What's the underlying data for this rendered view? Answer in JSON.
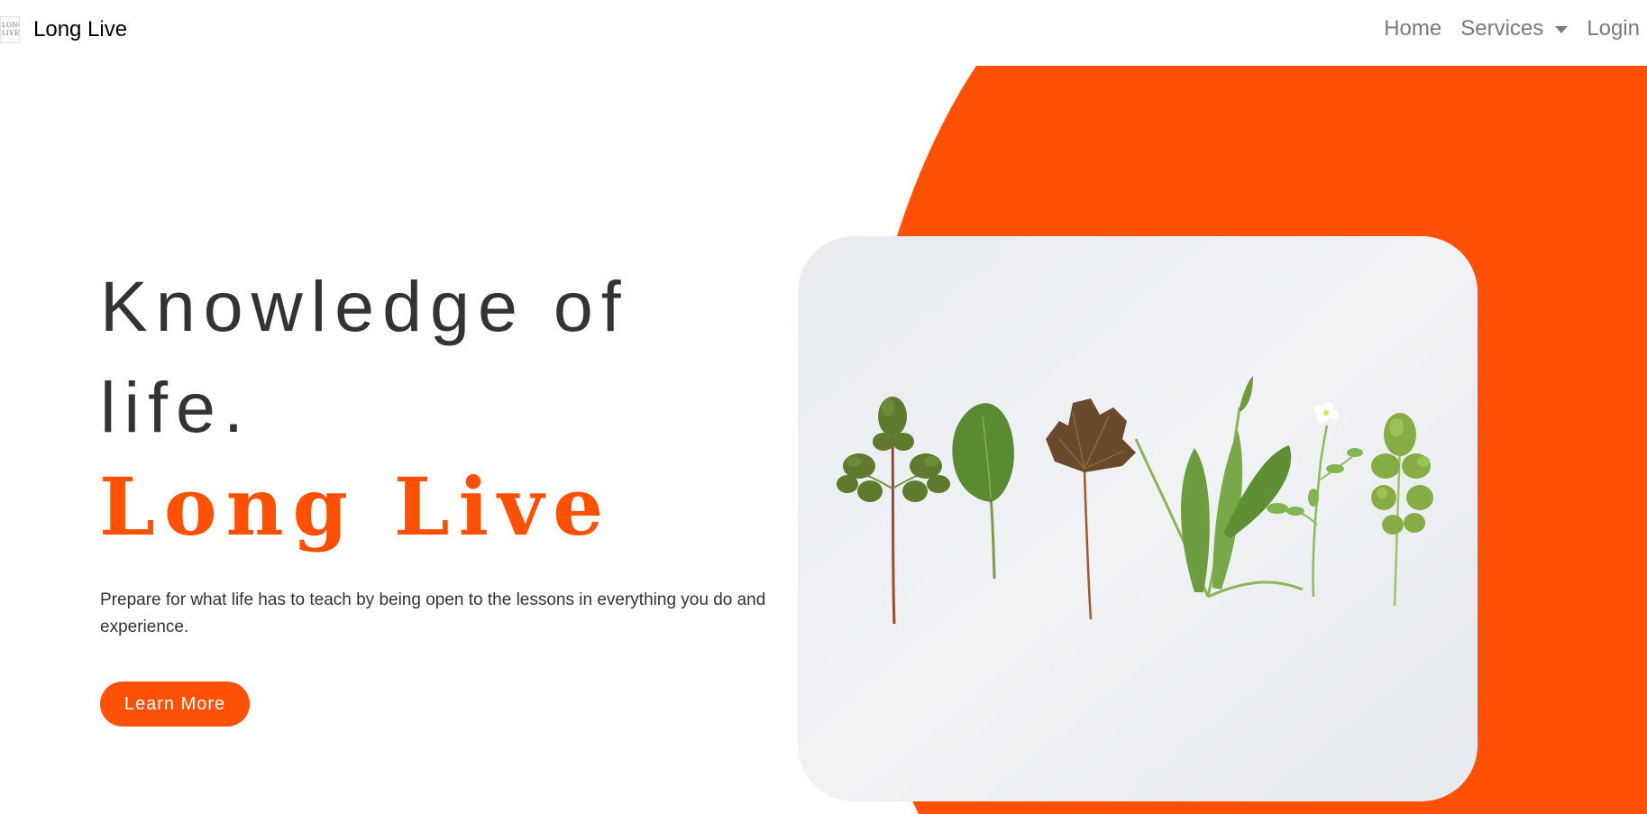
{
  "navbar": {
    "brand_logo_text": "LONG LIVE",
    "brand_name": "Long Live",
    "links": [
      {
        "label": "Home"
      },
      {
        "label": "Services"
      },
      {
        "label": "Login"
      }
    ]
  },
  "hero": {
    "title": "Knowledge of life.",
    "brand": "Long Live",
    "description": "Prepare for what life has to teach by being open to the lessons in everything you do and experience.",
    "button_label": "Learn More"
  },
  "colors": {
    "accent": "#ff5005",
    "text_dark": "#333333",
    "nav_text": "#7a7a7a",
    "card_bg": "#eef0f2"
  },
  "icons": {
    "dropdown": "chevron-down-icon",
    "logo": "long-live-logo"
  }
}
